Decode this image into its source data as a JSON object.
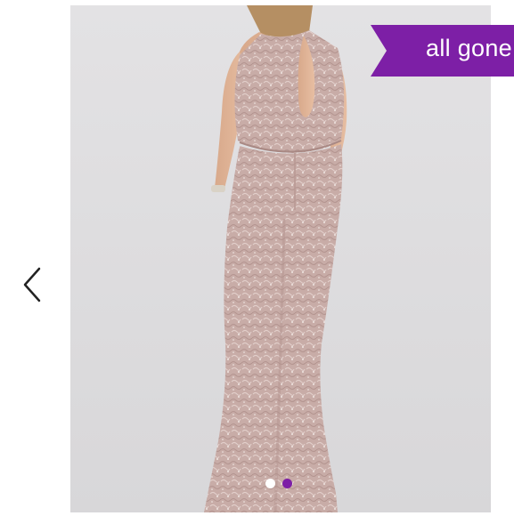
{
  "listing": {
    "status_badge": "all gone",
    "photo_subject": "back-view-lace-gown-photo"
  },
  "carousel": {
    "prev_icon": "chevron-left-icon",
    "current_index": 2,
    "total": 2
  },
  "colors": {
    "badge": "#7d1fa6",
    "dot_active": "#7d1fa6",
    "dot_inactive": "#ffffff",
    "photo_bg": "#e0dfe1",
    "dress": "#c9ada8"
  }
}
